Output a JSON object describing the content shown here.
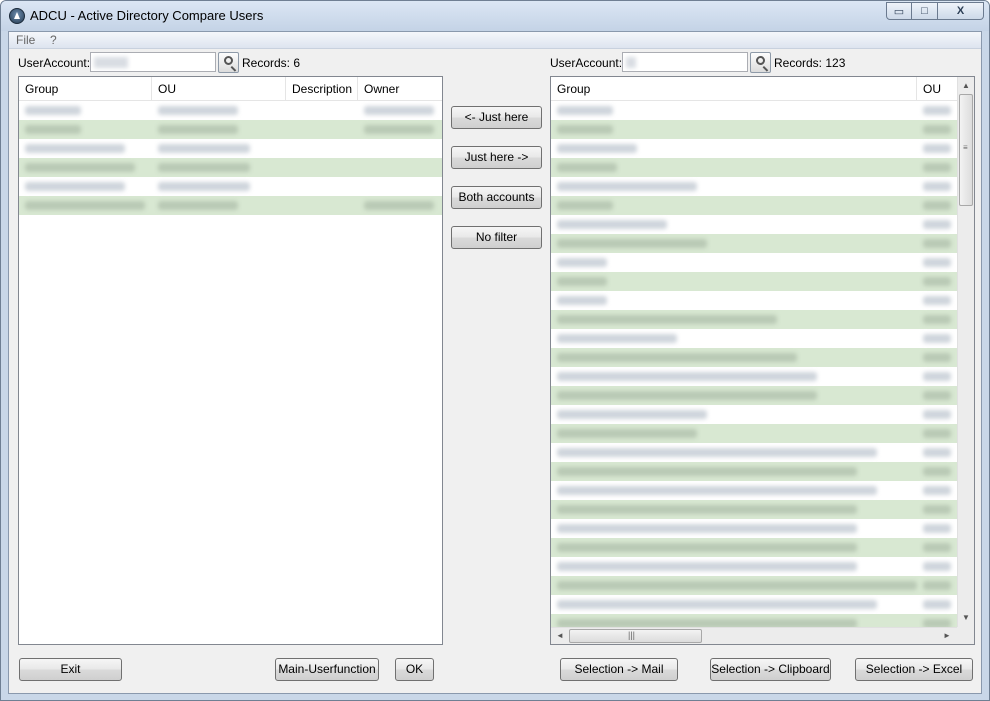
{
  "window": {
    "title": "ADCU - Active Directory Compare Users",
    "minimize": "▭",
    "maximize": "□",
    "close": "X"
  },
  "menu": {
    "file": "File",
    "help": "?"
  },
  "left": {
    "useraccount_label": "UserAccount:",
    "records_label": "Records: 6",
    "columns": [
      "Group",
      "OU",
      "Description",
      "Owner"
    ],
    "row_count": 6
  },
  "right": {
    "useraccount_label": "UserAccount:",
    "records_label": "Records: 123",
    "columns": [
      "Group",
      "OU"
    ],
    "visible_row_count": 28
  },
  "filter_buttons": {
    "just_here_left": "<- Just here",
    "just_here_right": "Just here ->",
    "both_accounts": "Both accounts",
    "no_filter": "No filter"
  },
  "footer_buttons": {
    "exit": "Exit",
    "main_userfunction": "Main-Userfunction",
    "ok": "OK",
    "selection_mail": "Selection -> Mail",
    "selection_clipboard": "Selection -> Clipboard",
    "selection_excel": "Selection -> Excel"
  },
  "scroll_glyphs": {
    "up": "▲",
    "down": "▼",
    "left": "◄",
    "right": "►",
    "grip": "|||"
  },
  "colors": {
    "row_alt": "#d8e8d2",
    "blur_text": "#c9cfd6"
  }
}
